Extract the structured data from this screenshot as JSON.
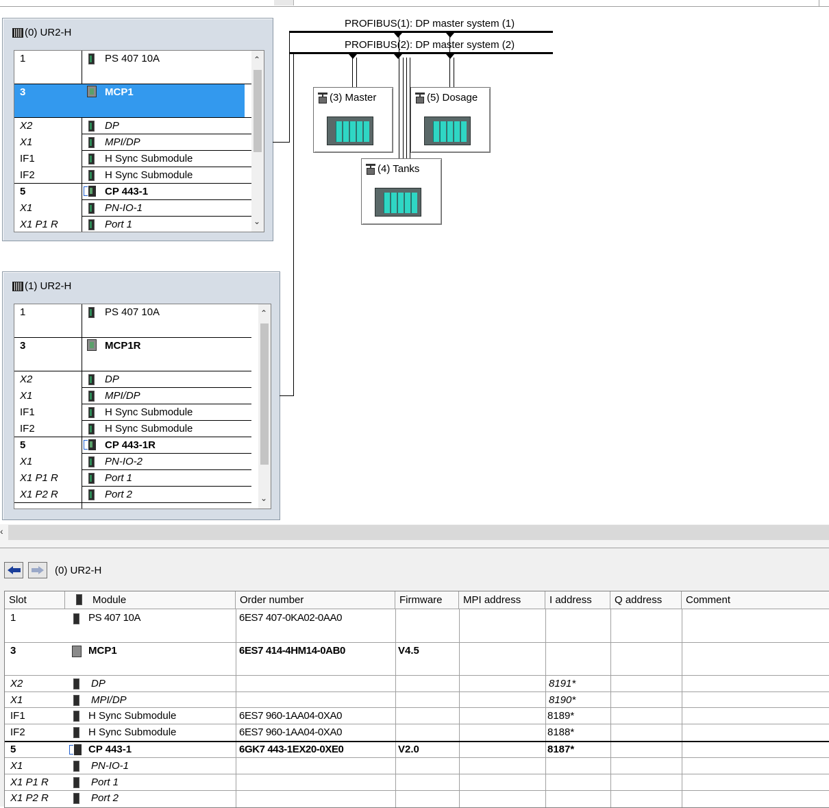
{
  "racks": [
    {
      "title": "(0) UR2-H",
      "rows": [
        {
          "slot": "1",
          "module": "PS 407 10A"
        },
        {
          "slot": "3",
          "module": "MCP1"
        },
        {
          "slot": "X2",
          "module": "DP"
        },
        {
          "slot": "X1",
          "module": "MPI/DP"
        },
        {
          "slot": "IF1",
          "module": "H Sync Submodule"
        },
        {
          "slot": "IF2",
          "module": "H Sync Submodule"
        },
        {
          "slot": "5",
          "module": "CP 443-1"
        },
        {
          "slot": "X1",
          "module": "PN-IO-1"
        },
        {
          "slot": "X1 P1 R",
          "module": "Port 1"
        }
      ]
    },
    {
      "title": "(1) UR2-H",
      "rows": [
        {
          "slot": "1",
          "module": "PS 407 10A"
        },
        {
          "slot": "3",
          "module": "MCP1R"
        },
        {
          "slot": "X2",
          "module": "DP"
        },
        {
          "slot": "X1",
          "module": "MPI/DP"
        },
        {
          "slot": "IF1",
          "module": "H Sync Submodule"
        },
        {
          "slot": "IF2",
          "module": "H Sync Submodule"
        },
        {
          "slot": "5",
          "module": "CP 443-1R"
        },
        {
          "slot": "X1",
          "module": "PN-IO-2"
        },
        {
          "slot": "X1 P1 R",
          "module": "Port 1"
        },
        {
          "slot": "X1 P2 R",
          "module": "Port 2"
        }
      ]
    }
  ],
  "profibus": {
    "bus1": "PROFIBUS(1): DP master system (1)",
    "bus2": "PROFIBUS(2): DP master system (2)"
  },
  "stations": [
    {
      "label": "(3) Master"
    },
    {
      "label": "(5) Dosage"
    },
    {
      "label": "(4) Tanks"
    }
  ],
  "detail": {
    "path": "(0)  UR2-H",
    "columns": [
      "Slot",
      "Module",
      "Order number",
      "Firmware",
      "MPI address",
      "I address",
      "Q address",
      "Comment"
    ],
    "rows": [
      {
        "slot": "1",
        "module": "PS 407 10A",
        "order": "6ES7 407-0KA02-0AA0",
        "firmware": "",
        "i_address": ""
      },
      {
        "slot": "3",
        "module": "MCP1",
        "order": "6ES7 414-4HM14-0AB0",
        "firmware": "V4.5",
        "i_address": ""
      },
      {
        "slot": "X2",
        "module": "DP",
        "order": "",
        "firmware": "",
        "i_address": "8191*"
      },
      {
        "slot": "X1",
        "module": "MPI/DP",
        "order": "",
        "firmware": "",
        "i_address": "8190*"
      },
      {
        "slot": "IF1",
        "module": "H Sync Submodule",
        "order": "6ES7 960-1AA04-0XA0",
        "firmware": "",
        "i_address": "8189*"
      },
      {
        "slot": "IF2",
        "module": "H Sync Submodule",
        "order": "6ES7 960-1AA04-0XA0",
        "firmware": "",
        "i_address": "8188*"
      },
      {
        "slot": "5",
        "module": "CP 443-1",
        "order": "6GK7 443-1EX20-0XE0",
        "firmware": "V2.0",
        "i_address": "8187*"
      },
      {
        "slot": "X1",
        "module": "PN-IO-1",
        "order": "",
        "firmware": "",
        "i_address": ""
      },
      {
        "slot": "X1 P1 R",
        "module": "Port 1",
        "order": "",
        "firmware": "",
        "i_address": ""
      },
      {
        "slot": "X1 P2 R",
        "module": "Port 2",
        "order": "",
        "firmware": "",
        "i_address": ""
      }
    ]
  },
  "colors": {
    "selection": "#3399ee",
    "module_teal": "#2fd6c4",
    "rack_bg": "#d6dde6"
  }
}
